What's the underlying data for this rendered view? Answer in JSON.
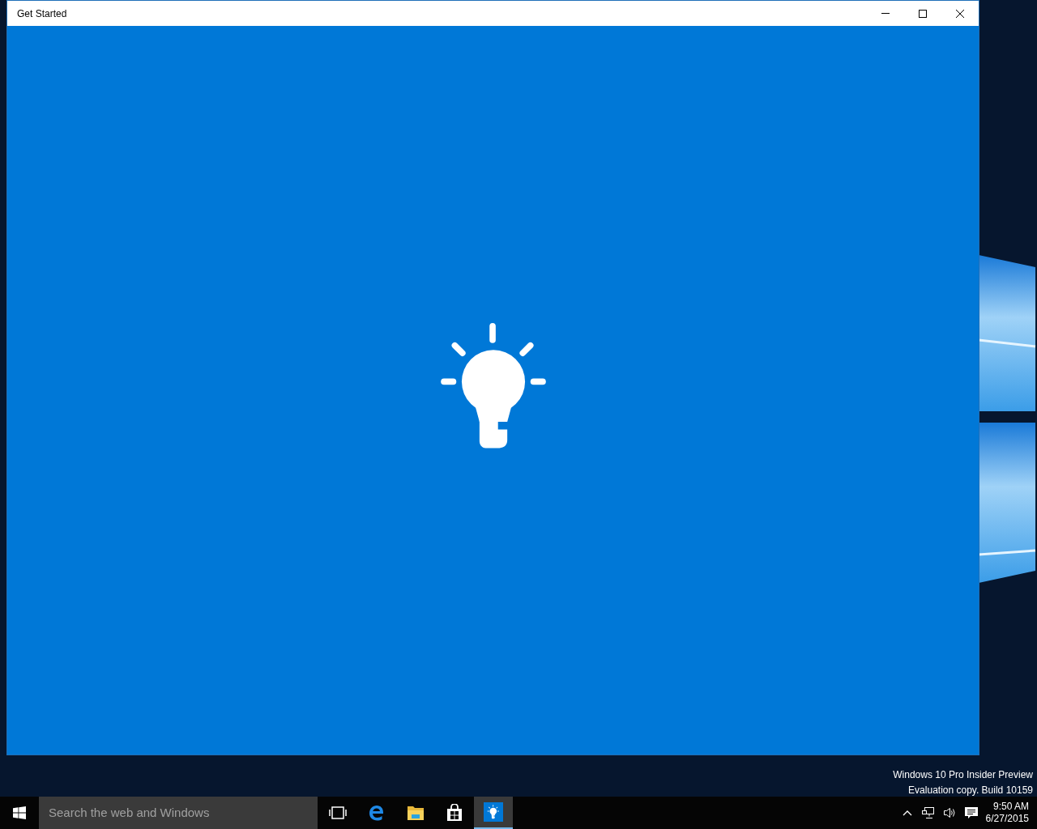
{
  "window": {
    "title": "Get Started"
  },
  "desktop": {
    "build_lines": [
      "Windows 10 Pro Insider Preview",
      "Evaluation copy. Build 10159"
    ]
  },
  "taskbar": {
    "search": {
      "placeholder": "Search the web and Windows"
    },
    "apps": [
      {
        "kind": "task-view",
        "selected": false
      },
      {
        "kind": "browser",
        "selected": false
      },
      {
        "kind": "folder",
        "selected": false
      },
      {
        "kind": "store",
        "selected": false
      },
      {
        "kind": "tips",
        "selected": true
      }
    ],
    "clock": {
      "time": "9:50 AM",
      "date": "6/27/2015"
    }
  }
}
